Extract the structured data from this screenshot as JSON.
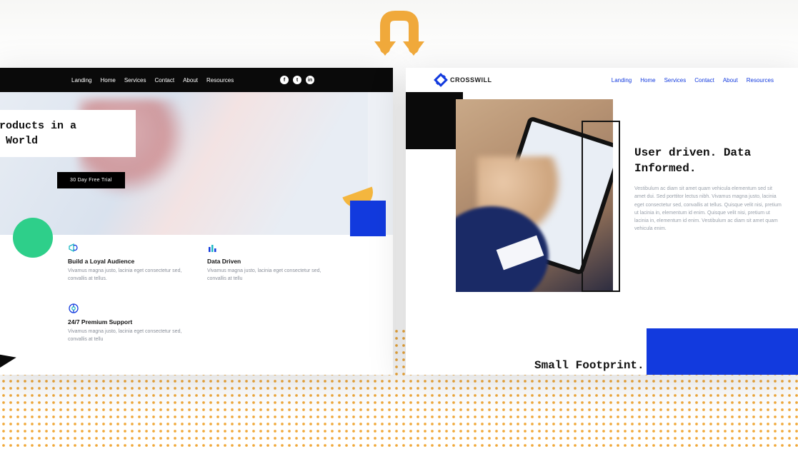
{
  "left": {
    "nav": [
      "Landing",
      "Home",
      "Services",
      "Contact",
      "About",
      "Resources"
    ],
    "hero_title": "Products in a\nx World",
    "cta": "30 Day Free Trial",
    "features": [
      {
        "icon": "megaphone",
        "title": "Build a Loyal Audience",
        "desc": "Vivamus magna justo, lacinia eget consectetur sed, convallis at tellus."
      },
      {
        "icon": "bars",
        "title": "Data Driven",
        "desc": "Vivamus magna justo, lacinia eget consectetur sed, convallis at tellu"
      },
      {
        "icon": "support",
        "title": "24/7 Premium Support",
        "desc": "Vivamus magna justo, lacinia eget consectetur sed, convallis at tellu"
      }
    ]
  },
  "right": {
    "brand": "CROSSWILL",
    "nav": [
      "Landing",
      "Home",
      "Services",
      "Contact",
      "About",
      "Resources"
    ],
    "headline": "User driven. Data Informed.",
    "body": "Vestibulum ac diam sit amet quam vehicula elementum sed sit amet dui. Sed porttitor lectus nibh. Vivamus magna justo, lacinia eget consectetur sed, convallis at tellus. Quisque velit nisi, pretium ut lacinia in, elementum id enim. Quisque velit nisi, pretium ut lacinia in, elementum id enim. Vestibulum ac diam sit amet quam vehicula enim.",
    "sub_headline": "Small Footprint."
  }
}
